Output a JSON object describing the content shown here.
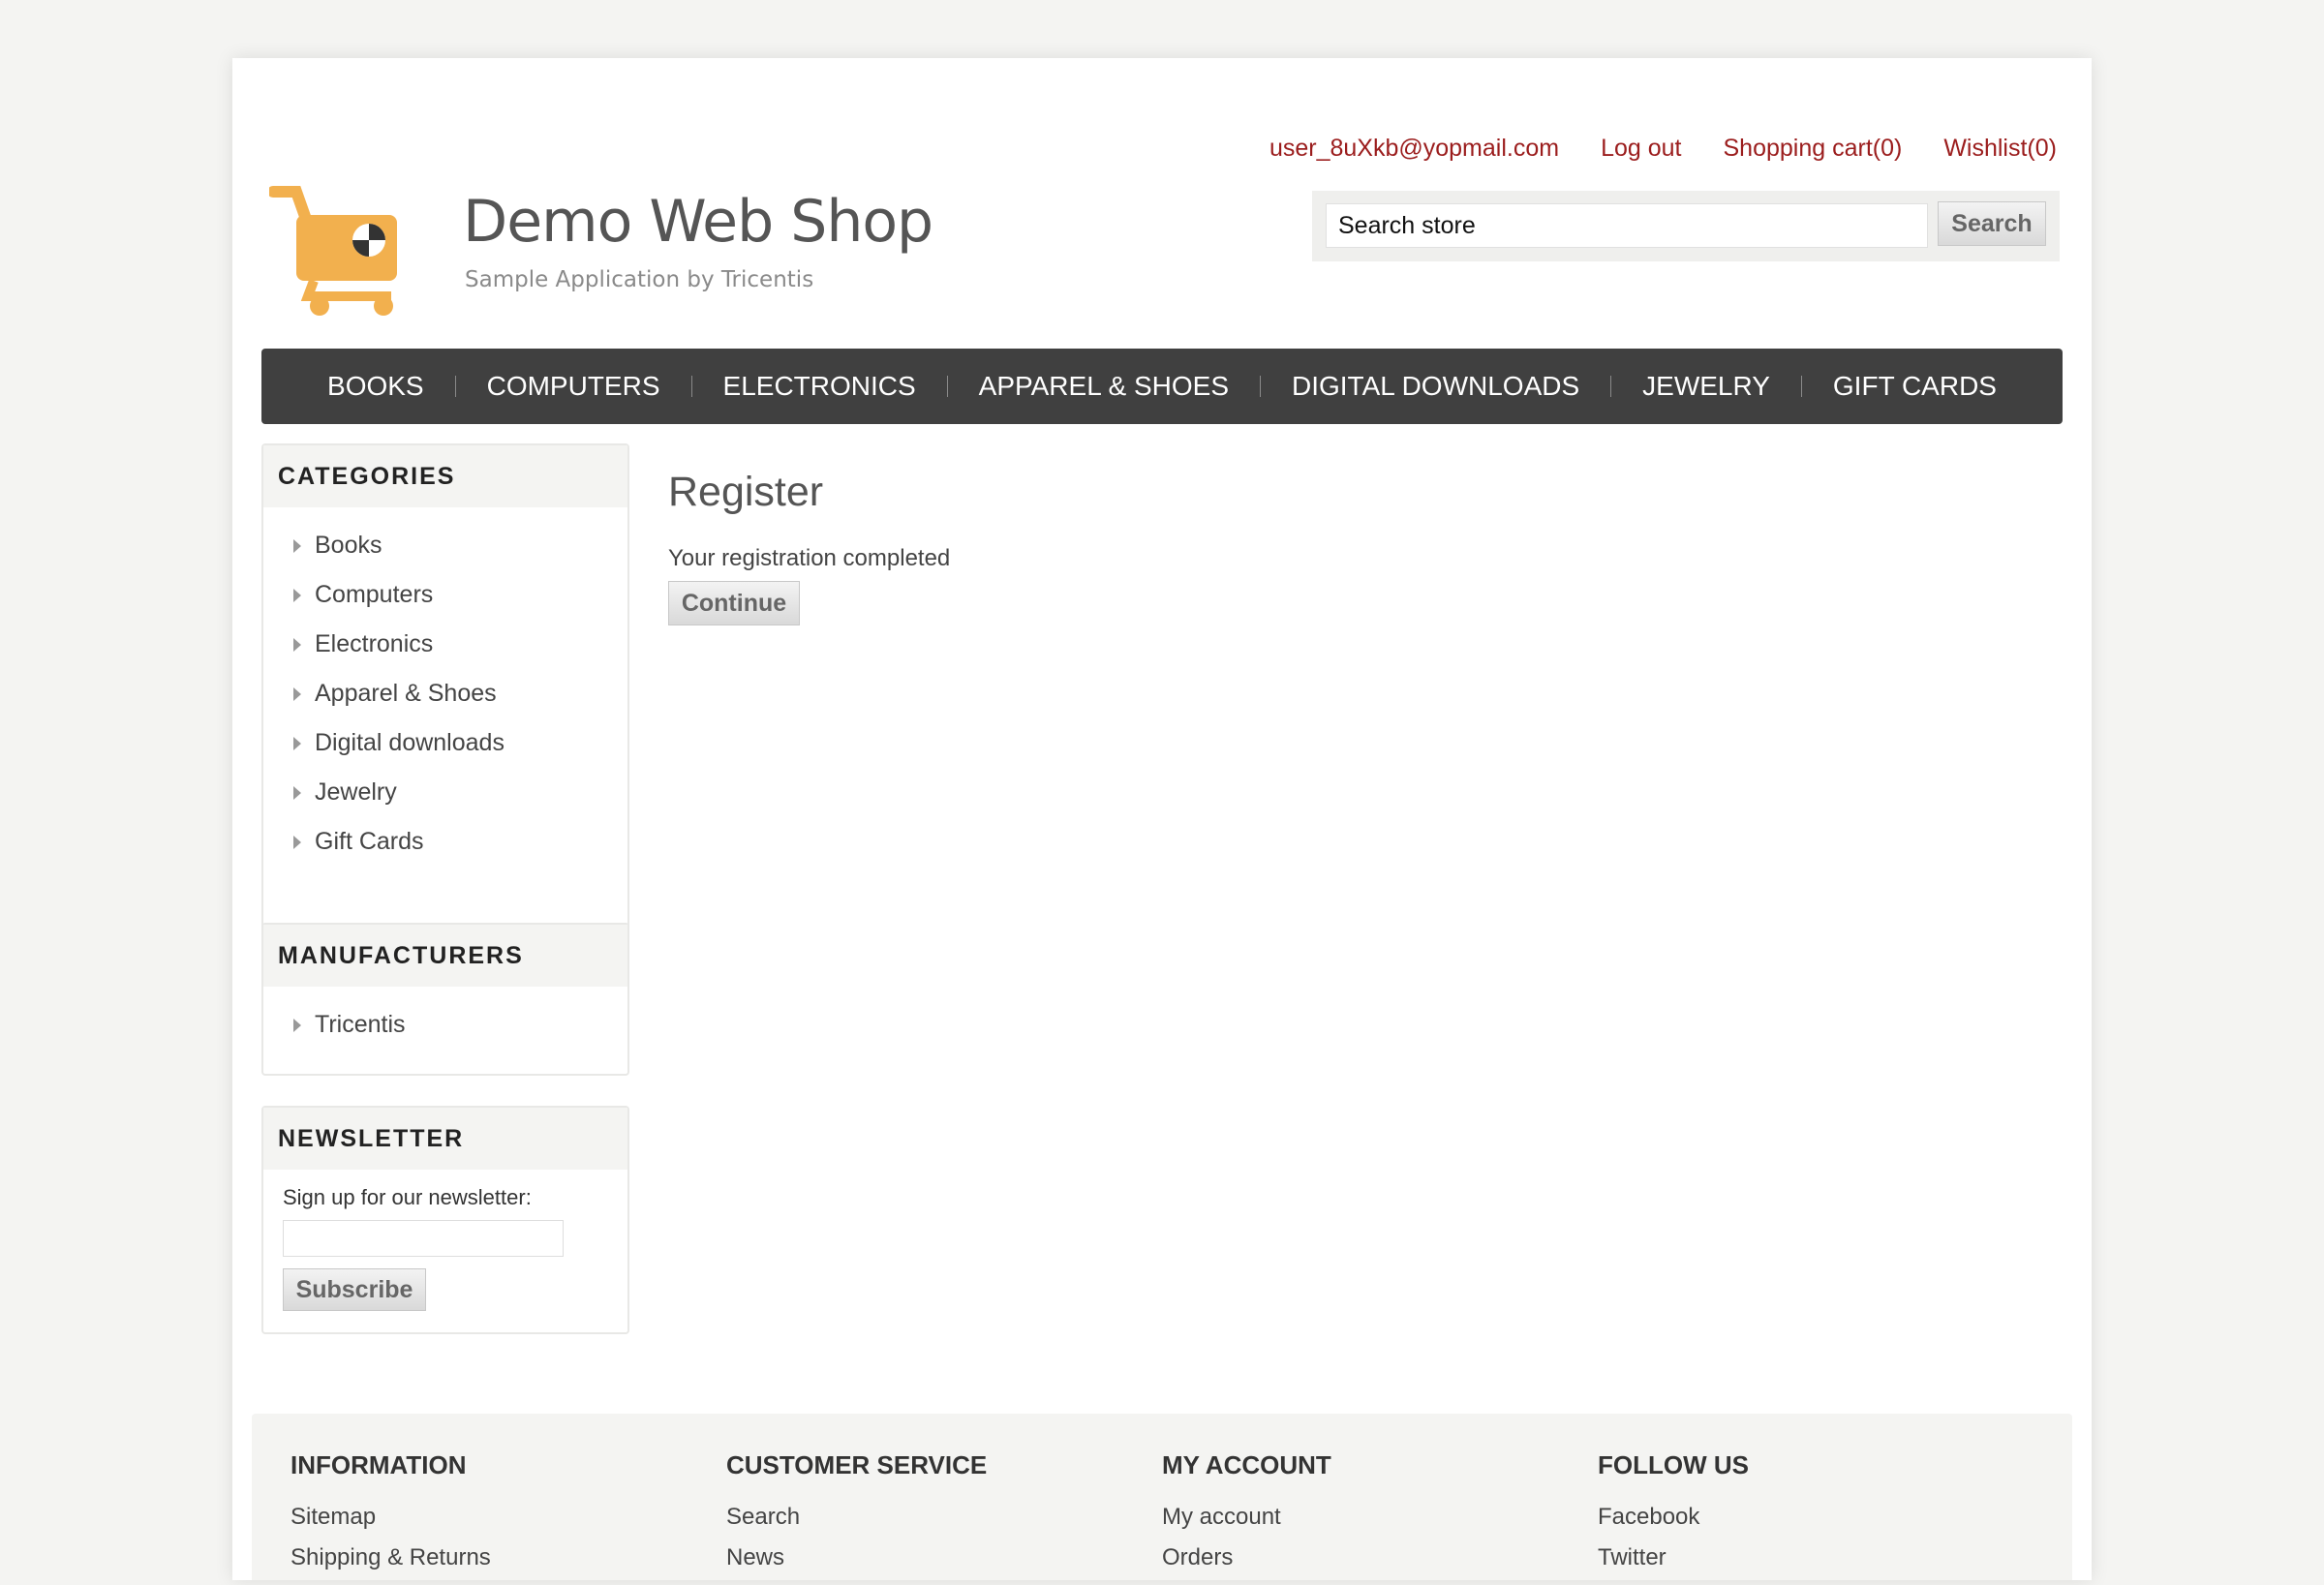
{
  "logo": {
    "title": "Demo Web Shop",
    "subtitle": "Sample Application by Tricentis",
    "icon": "cart-icon",
    "accent": "#f2b04e"
  },
  "header": {
    "links": [
      {
        "name": "account-email-link",
        "label": "user_8uXkb@yopmail.com"
      },
      {
        "name": "logout-link",
        "label": "Log out"
      },
      {
        "name": "shopping-cart-link",
        "label": "Shopping cart(0)"
      },
      {
        "name": "wishlist-link",
        "label": "Wishlist(0)"
      }
    ],
    "search": {
      "value": "Search store",
      "button": "Search"
    }
  },
  "nav": [
    "BOOKS",
    "COMPUTERS",
    "ELECTRONICS",
    "APPAREL & SHOES",
    "DIGITAL DOWNLOADS",
    "JEWELRY",
    "GIFT CARDS"
  ],
  "sidebar": {
    "categories": {
      "title": "CATEGORIES",
      "items": [
        "Books",
        "Computers",
        "Electronics",
        "Apparel & Shoes",
        "Digital downloads",
        "Jewelry",
        "Gift Cards"
      ]
    },
    "manufacturers": {
      "title": "MANUFACTURERS",
      "items": [
        "Tricentis"
      ]
    },
    "newsletter": {
      "title": "NEWSLETTER",
      "label": "Sign up for our newsletter:",
      "input_value": "",
      "button": "Subscribe"
    }
  },
  "main": {
    "title": "Register",
    "message": "Your registration completed",
    "continue": "Continue"
  },
  "footer": {
    "columns": [
      {
        "title": "INFORMATION",
        "items": [
          "Sitemap",
          "Shipping & Returns"
        ]
      },
      {
        "title": "CUSTOMER SERVICE",
        "items": [
          "Search",
          "News"
        ]
      },
      {
        "title": "MY ACCOUNT",
        "items": [
          "My account",
          "Orders"
        ]
      },
      {
        "title": "FOLLOW US",
        "items": [
          "Facebook",
          "Twitter"
        ]
      }
    ]
  },
  "colors": {
    "link": "#9b1d1d",
    "nav_bg": "#404040",
    "page_bg": "#f4f4f2"
  }
}
